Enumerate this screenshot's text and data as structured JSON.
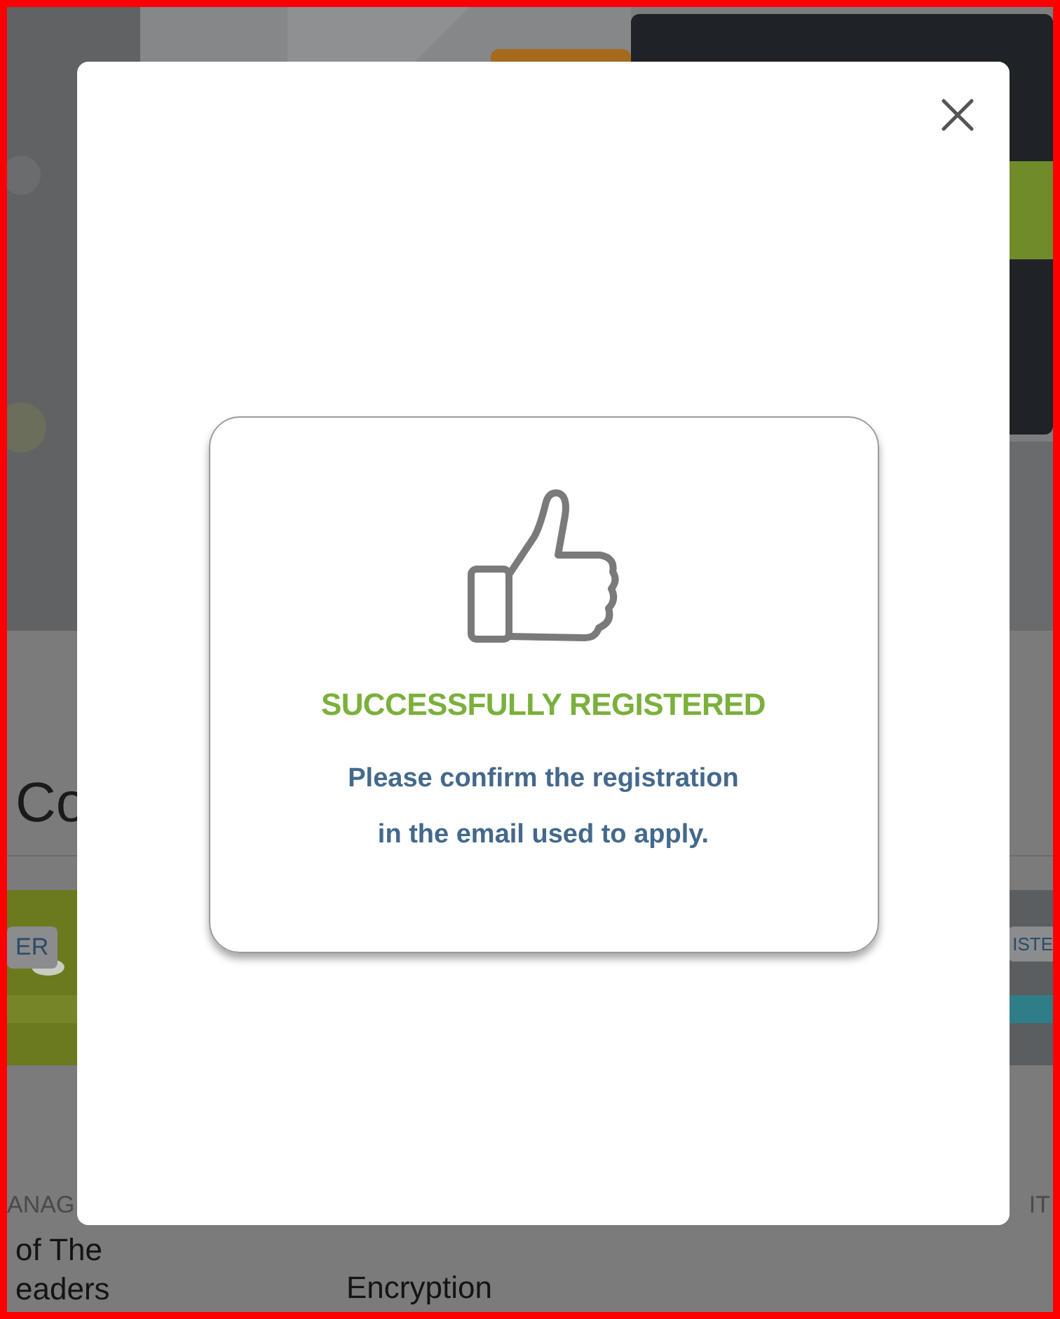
{
  "background_page": {
    "heading": "Co",
    "cards": [
      {
        "badge": "ER",
        "category": "ANAG",
        "title_lines": [
          "of The",
          "eaders"
        ]
      },
      {
        "title_lines": [
          "Encryption"
        ]
      },
      {
        "badge": "ISTE",
        "category": "IT"
      }
    ]
  },
  "modal": {
    "title": "SUCCESSFULLY REGISTERED",
    "message": "Please confirm the registration\nin the email used to apply."
  }
}
